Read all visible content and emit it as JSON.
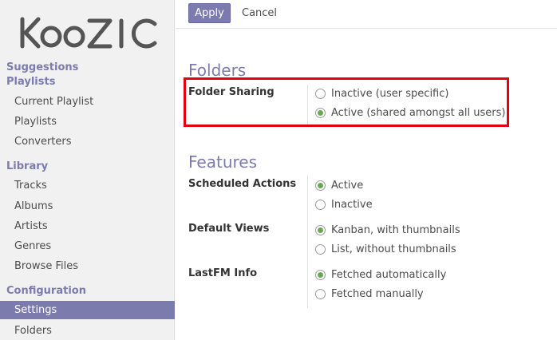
{
  "app": {
    "logo_text": "KooZIC"
  },
  "sidebar": {
    "sections": [
      {
        "title": "Suggestions",
        "items": []
      },
      {
        "title": "Playlists",
        "items": [
          "Current Playlist",
          "Playlists",
          "Converters"
        ]
      },
      {
        "title": "Library",
        "items": [
          "Tracks",
          "Albums",
          "Artists",
          "Genres",
          "Browse Files"
        ]
      },
      {
        "title": "Configuration",
        "items": [
          "Settings",
          "Folders"
        ]
      }
    ],
    "active_item": "Settings"
  },
  "toolbar": {
    "apply_label": "Apply",
    "cancel_label": "Cancel"
  },
  "folders": {
    "title": "Folders",
    "folder_sharing": {
      "label": "Folder Sharing",
      "options": [
        "Inactive (user specific)",
        "Active (shared amongst all users)"
      ],
      "selected": 1
    }
  },
  "features": {
    "title": "Features",
    "scheduled_actions": {
      "label": "Scheduled Actions",
      "options": [
        "Active",
        "Inactive"
      ],
      "selected": 0
    },
    "default_views": {
      "label": "Default Views",
      "options": [
        "Kanban, with thumbnails",
        "List, without thumbnails"
      ],
      "selected": 0
    },
    "lastfm_info": {
      "label": "LastFM Info",
      "options": [
        "Fetched automatically",
        "Fetched manually"
      ],
      "selected": 0
    }
  },
  "colors": {
    "accent": "#7c7bad",
    "highlight": "#e3000f",
    "radio_checked": "#6aa84f"
  }
}
